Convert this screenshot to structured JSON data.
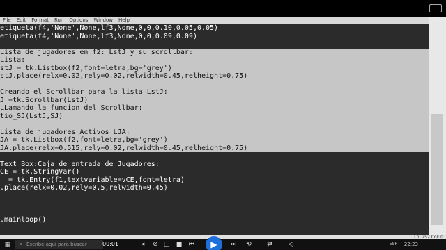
{
  "menubar": {
    "items": [
      "File",
      "Edit",
      "Format",
      "Run",
      "Options",
      "Window",
      "Help"
    ]
  },
  "editor": {
    "lines": [
      {
        "text": "etiqueta(f4,'None',None,lf3,None,0,0,0.10,0.05,0.05)",
        "sel": false
      },
      {
        "text": "etiqueta(f4,'None',None,lf3,None,0,0,0.09,0.09)",
        "sel": false
      },
      {
        "text": "",
        "sel": false
      },
      {
        "text": "Lista de jugadores en f2: LstJ y su scrollbar:",
        "sel": true
      },
      {
        "text": "Lista:",
        "sel": true
      },
      {
        "text": "stJ = tk.Listbox(f2,font=letra,bg='grey')",
        "sel": true
      },
      {
        "text": "stJ.place(relx=0.02,rely=0.02,relwidth=0.45,relheight=0.75)",
        "sel": true
      },
      {
        "text": "",
        "sel": true
      },
      {
        "text": "Creando el Scrollbar para la lista LstJ:",
        "sel": true
      },
      {
        "text": "J =tk.Scrollbar(LstJ)",
        "sel": true
      },
      {
        "text": "LLamando la funcion del Scrollbar:",
        "sel": true
      },
      {
        "text": "tio_SJ(LstJ,SJ)",
        "sel": true
      },
      {
        "text": "",
        "sel": true
      },
      {
        "text": "Lista de jugadores Activos LJA:",
        "sel": true
      },
      {
        "text": "JA = tk.Listbox(f2,font=letra,bg='grey')",
        "sel": true
      },
      {
        "text": "JA.place(relx=0.515,rely=0.02,relwidth=0.45,relheight=0.75)",
        "sel": true
      },
      {
        "text": "",
        "sel": false
      },
      {
        "text": "Text Box:Caja de entrada de Jugadores:",
        "sel": false
      },
      {
        "text": "CE = tk.StringVar()",
        "sel": false
      },
      {
        "text": "  = tk.Entry(f1,textvariable=vCE,font=letra)",
        "sel": false
      },
      {
        "text": ".place(relx=0.02,rely=0.5,relwidth=0.45)",
        "sel": false
      },
      {
        "text": "",
        "sel": false
      },
      {
        "text": "",
        "sel": false
      },
      {
        "text": "",
        "sel": false
      },
      {
        "text": ".mainloop()",
        "sel": false
      }
    ]
  },
  "statusbar": {
    "text": "Ln: 252  Col: 0"
  },
  "taskbar": {
    "search_placeholder": "Escribe aquí para buscar",
    "media_time": "00:01",
    "language": "ESP",
    "clock": "22:23"
  },
  "icons": [
    "search-icon",
    "rewind-icon",
    "stop-icon",
    "fullscreen-icon",
    "skip-back-icon",
    "play-icon",
    "skip-forward-icon",
    "loop-icon",
    "shuffle-icon",
    "volume-icon"
  ]
}
